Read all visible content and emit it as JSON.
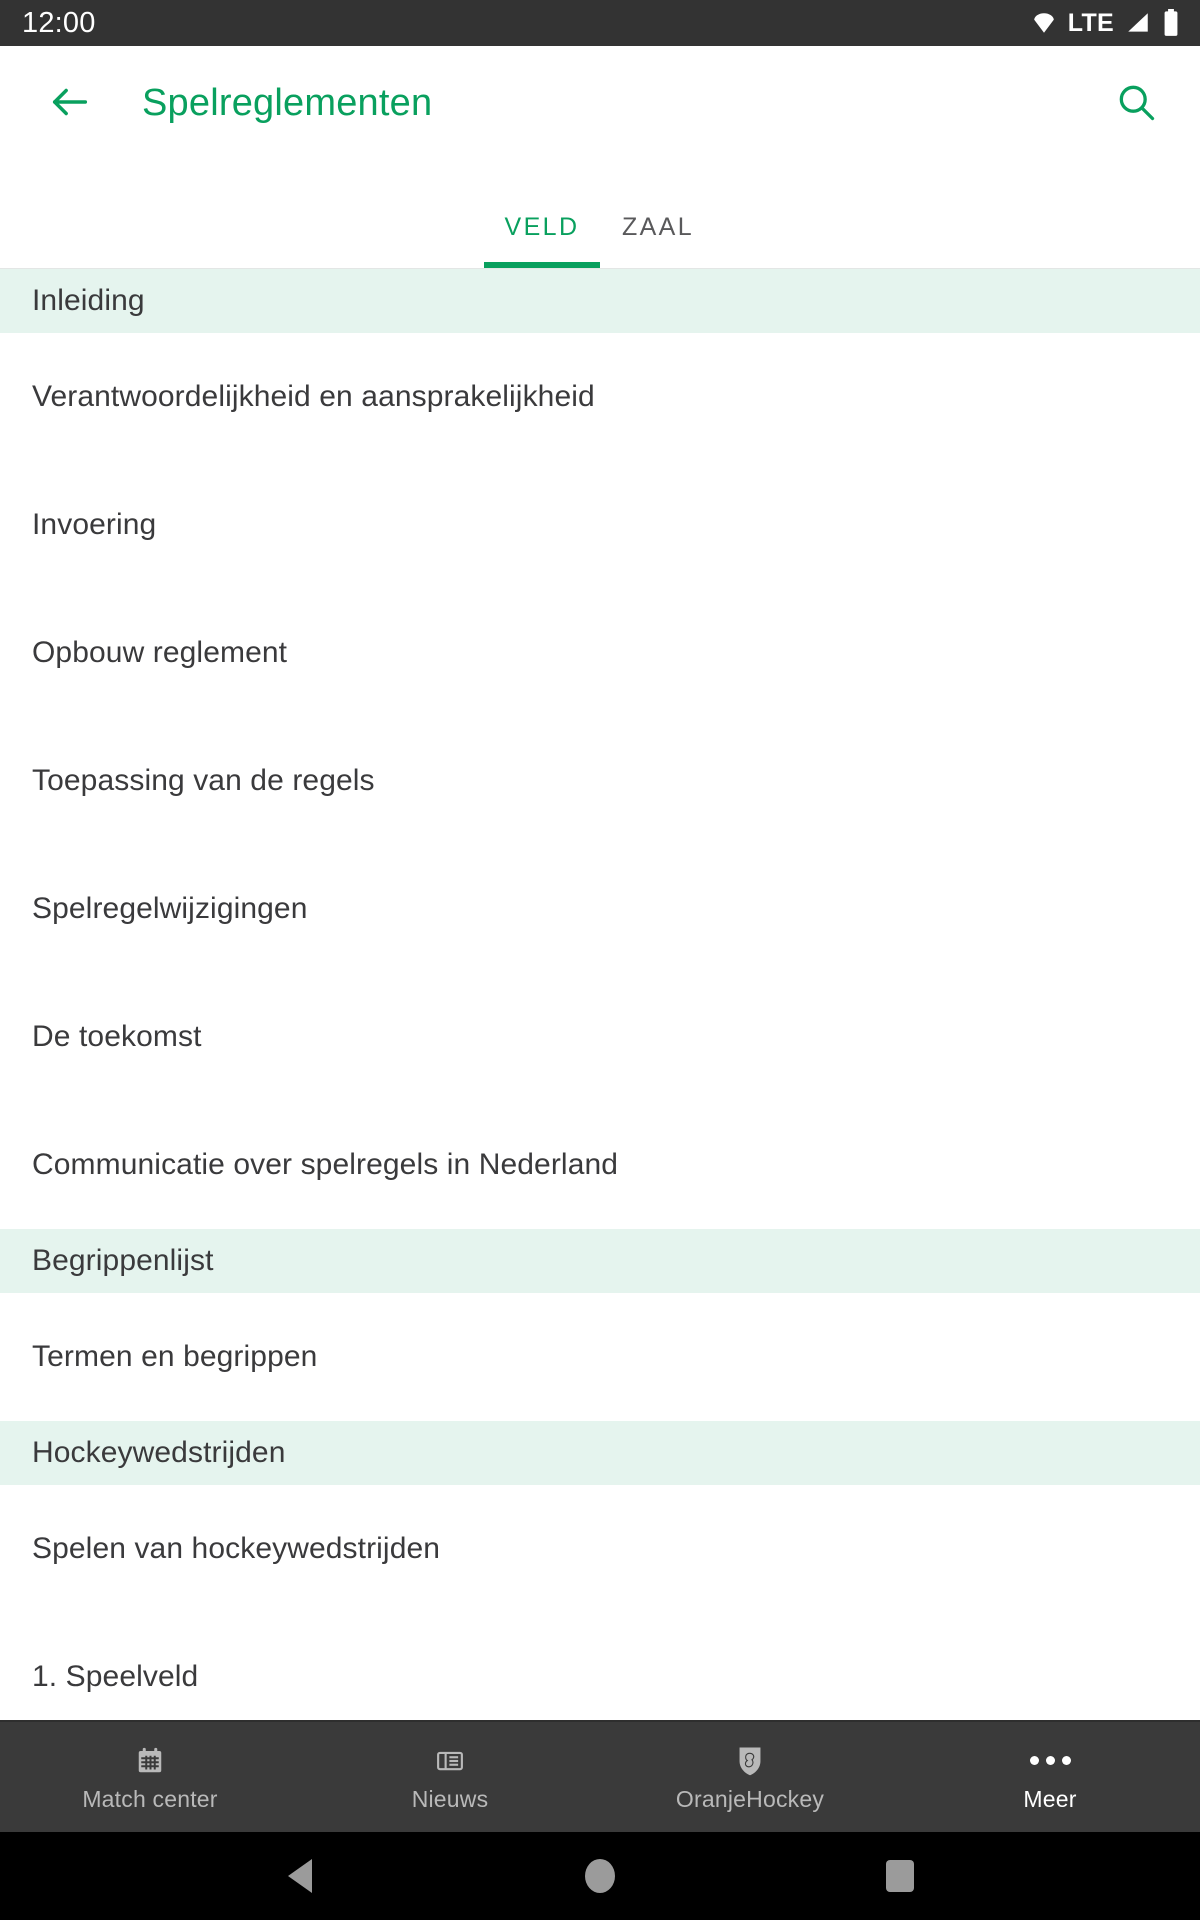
{
  "colors": {
    "accent_green": "#09a05e",
    "section_header_bg": "#e5f4ee",
    "status_bar_bg": "#333333",
    "bottom_nav_bg": "#3a3a3a",
    "text_primary": "#3a3a3c",
    "tab_inactive": "#59595b"
  },
  "status_bar": {
    "time": "12:00",
    "network_label": "LTE",
    "icons": [
      "wifi-icon",
      "signal-icon",
      "battery-icon"
    ]
  },
  "app_bar": {
    "back_icon": "arrow-back-icon",
    "title": "Spelreglementen",
    "search_icon": "search-icon"
  },
  "tabs": {
    "active_index": 0,
    "items": [
      {
        "label": "VELD",
        "active": true
      },
      {
        "label": "ZAAL",
        "active": false
      }
    ]
  },
  "list": [
    {
      "type": "header",
      "label": "Inleiding"
    },
    {
      "type": "item",
      "label": "Verantwoordelijkheid en aansprakelijkheid"
    },
    {
      "type": "item",
      "label": "Invoering"
    },
    {
      "type": "item",
      "label": "Opbouw reglement"
    },
    {
      "type": "item",
      "label": "Toepassing van de regels"
    },
    {
      "type": "item",
      "label": "Spelregelwijzigingen"
    },
    {
      "type": "item",
      "label": "De toekomst"
    },
    {
      "type": "item",
      "label": "Communicatie over spelregels in Nederland"
    },
    {
      "type": "header",
      "label": "Begrippenlijst"
    },
    {
      "type": "item",
      "label": "Termen en begrippen"
    },
    {
      "type": "header",
      "label": "Hockeywedstrijden"
    },
    {
      "type": "item",
      "label": "Spelen van hockeywedstrijden"
    },
    {
      "type": "item",
      "label": "1. Speelveld"
    }
  ],
  "bottom_nav": {
    "active_index": 3,
    "items": [
      {
        "label": "Match center",
        "icon": "calendar-icon",
        "active": false
      },
      {
        "label": "Nieuws",
        "icon": "newspaper-icon",
        "active": false
      },
      {
        "label": "OranjeHockey",
        "icon": "shield-lion-icon",
        "active": false
      },
      {
        "label": "Meer",
        "icon": "more-dots-icon",
        "active": true
      }
    ]
  },
  "system_nav": {
    "back": "triangle-back-icon",
    "home": "circle-home-icon",
    "recents": "square-recents-icon"
  }
}
